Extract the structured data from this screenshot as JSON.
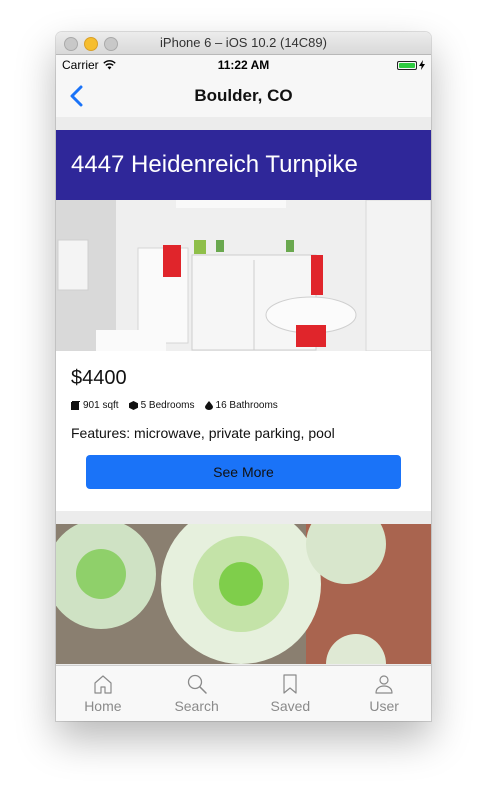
{
  "window": {
    "title": "iPhone 6 – iOS 10.2 (14C89)"
  },
  "status_bar": {
    "carrier": "Carrier",
    "time": "11:22 AM",
    "battery_color": "#2ecc40",
    "wifi_icon": "wifi-icon",
    "battery_icon": "battery-icon",
    "charging_icon": "charging-icon"
  },
  "nav": {
    "title": "Boulder, CO",
    "back_icon": "chevron-left-icon"
  },
  "listings": [
    {
      "address": "4447 Heidenreich Turnpike",
      "header_color": "#2f2799",
      "price": "$4400",
      "sqft": "901 sqft",
      "bedrooms": "5 Bedrooms",
      "bathrooms": "16 Bathrooms",
      "features": "Features: microwave, private parking, pool",
      "button_label": "See More",
      "button_color": "#1a73f8"
    }
  ],
  "tabs": [
    {
      "label": "Home",
      "icon": "home-icon"
    },
    {
      "label": "Search",
      "icon": "search-icon"
    },
    {
      "label": "Saved",
      "icon": "bookmark-icon"
    },
    {
      "label": "User",
      "icon": "user-icon"
    }
  ]
}
